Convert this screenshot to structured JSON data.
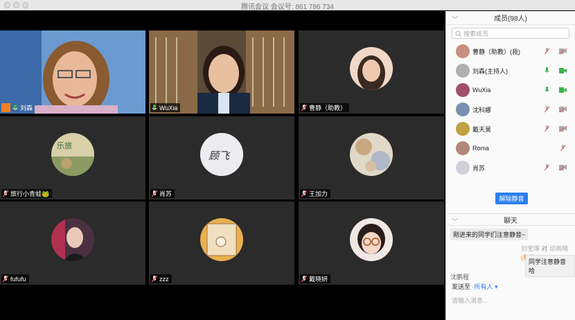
{
  "window": {
    "title": "腾讯会议 会议号: 861 786 734"
  },
  "tiles": [
    {
      "name": "刘森",
      "mic": "on",
      "kind": "video-woman1"
    },
    {
      "name": "WuXia",
      "mic": "on",
      "kind": "video-woman2"
    },
    {
      "name": "曹静（助教）",
      "mic": "off",
      "kind": "avatar",
      "color": "#d9a890"
    },
    {
      "name": "旅行小青蛙🐸",
      "mic": "off",
      "kind": "avatar",
      "color": "#9db780"
    },
    {
      "name": "肖苏",
      "mic": "off",
      "kind": "avatar",
      "color": "#e8e8ec",
      "glyph": "顾飞"
    },
    {
      "name": "王加力",
      "mic": "off",
      "kind": "avatar",
      "color": "#c8b89a"
    },
    {
      "name": "fufufu",
      "mic": "off",
      "kind": "avatar",
      "color": "#5a3d4a"
    },
    {
      "name": "zzz",
      "mic": "off",
      "kind": "avatar",
      "color": "#e0a850"
    },
    {
      "name": "戴晓妍",
      "mic": "off",
      "kind": "avatar",
      "color": "#e8cfc8"
    }
  ],
  "members": {
    "title": "成员(98人)",
    "search_placeholder": "搜索成员",
    "list": [
      {
        "name": "曹静（助教）(我)",
        "mic": "off",
        "cam": "off",
        "color": "#c89080"
      },
      {
        "name": "刘森(主持人)",
        "mic": "on",
        "cam": "on",
        "color": "#b0b0b0"
      },
      {
        "name": "WuXia",
        "mic": "on",
        "cam": "on",
        "color": "#a0506a"
      },
      {
        "name": "沈科娜",
        "mic": "off",
        "cam": "off",
        "color": "#7a90b0"
      },
      {
        "name": "戴天昊",
        "mic": "off",
        "cam": "off",
        "color": "#c0a040"
      },
      {
        "name": "Roma",
        "mic": "off",
        "cam": "none",
        "color": "#b08878"
      },
      {
        "name": "肖苏",
        "mic": "off",
        "cam": "off",
        "color": "#d0d0dc"
      }
    ],
    "unmute_all": "解除静音"
  },
  "chat": {
    "title": "聊天",
    "messages": [
      {
        "text": "刚进来的同学们注意静音~"
      },
      {
        "from": "刘宝琢",
        "to": "邱雨晴",
        "private": "(私聊)",
        "text": "同学注意静音哈"
      }
    ],
    "sender": "沈鹏程",
    "send_to_label": "发送至",
    "send_to_value": "所有人",
    "input_placeholder": "请输入消息..."
  },
  "colors": {
    "accent": "#2d7ff0",
    "mic_on": "#3ab54a",
    "muted": "#e05050"
  }
}
